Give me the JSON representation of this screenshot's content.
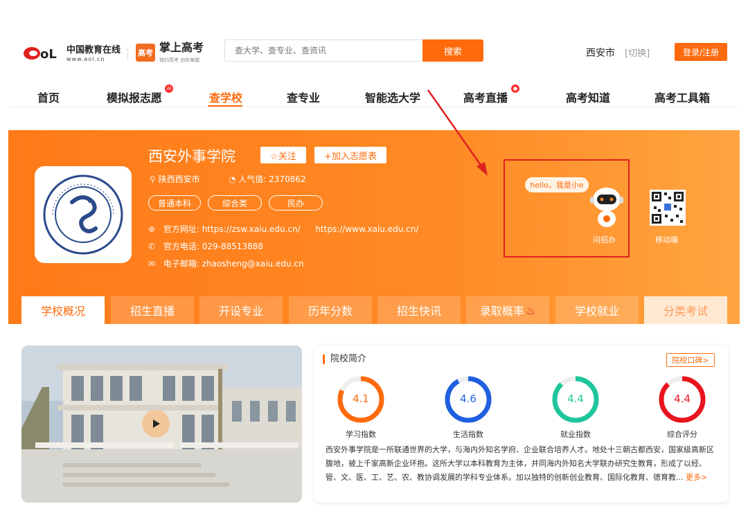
{
  "header": {
    "logo_eol_cn": "中国教育在线",
    "logo_eol_url": "www.eol.cn",
    "logo_gk_badge": "高考",
    "logo_gk_title": "掌上高考",
    "logo_gk_sub": "我的高考 由你掌握",
    "search_placeholder": "查大学、查专业、查资讯",
    "search_button": "搜索",
    "city": "西安市",
    "city_switch": "[切换]",
    "login_button": "登录/注册"
  },
  "nav": {
    "items": [
      "首页",
      "模拟报志愿",
      "查学校",
      "查专业",
      "智能选大学",
      "高考直播",
      "高考知道",
      "高考工具箱"
    ],
    "active": "查学校"
  },
  "school": {
    "name": "西安外事学院",
    "follow": "☆关注",
    "add_wish": "+加入志愿表",
    "location": "陕西西安市",
    "popularity_label": "人气值:",
    "popularity_value": "2370862",
    "tags": [
      "普通本科",
      "综合类",
      "民办"
    ],
    "website_label": "官方网址:",
    "website_1": "https://zsw.xaiu.edu.cn/",
    "website_2": "https://www.xaiu.edu.cn/",
    "phone_label": "官方电话:",
    "phone": "029-88513888",
    "email_label": "电子邮箱:",
    "email": "zhaosheng@xaiu.edu.cn",
    "bot_bubble": "hello，我是小e",
    "bot_label": "问招办",
    "mobile_label": "移动端"
  },
  "tabs": [
    "学校概况",
    "招生直播",
    "开设专业",
    "历年分数",
    "招生快讯",
    "录取概率",
    "学校就业",
    "分类考试"
  ],
  "intro": {
    "title": "院校简介",
    "reputation_button": "院校口碑>",
    "ratings": [
      {
        "label": "学习指数",
        "value": "4.1",
        "color": "#ff6a0c"
      },
      {
        "label": "生活指数",
        "value": "4.6",
        "color": "#1f5fe0"
      },
      {
        "label": "就业指数",
        "value": "4.4",
        "color": "#1ec69a"
      },
      {
        "label": "综合评分",
        "value": "4.4",
        "color": "#e8141e"
      }
    ],
    "text": "西安外事学院是一所联通世界的大学，与海内外知名学府、企业联合培养人才。地处十三朝古都西安，国家级高新区腹地，被上千家高新企业环抱。这所大学以本科教育为主体，并同海内外知名大学联办研究生教育，形成了以经、管、文、医、工、艺、农、教协调发展的学科专业体系。加以独特的创新创业教育、国际化教育、德育教...",
    "more": "更多>"
  }
}
